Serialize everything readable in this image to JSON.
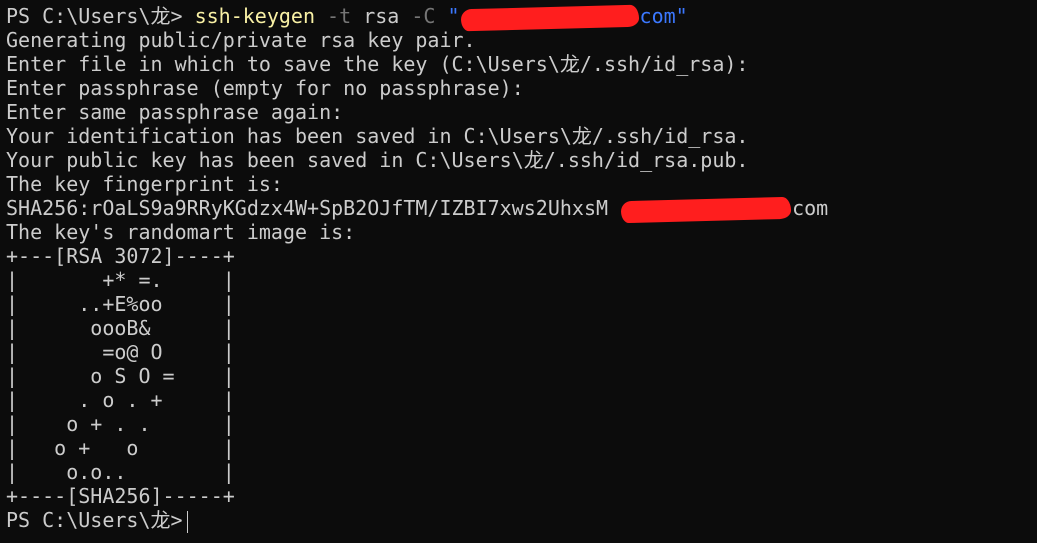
{
  "prompt": "PS C:\\Users\\龙> ",
  "command": {
    "exe": "ssh-keygen",
    "flag_t": "-t",
    "arg_t": "rsa",
    "flag_c": "-C",
    "quote_open": "\"",
    "email_tail": "com\""
  },
  "output": {
    "l1": "Generating public/private rsa key pair.",
    "l2": "Enter file in which to save the key (C:\\Users\\龙/.ssh/id_rsa):",
    "l3": "Enter passphrase (empty for no passphrase):",
    "l4": "Enter same passphrase again:",
    "l5": "Your identification has been saved in C:\\Users\\龙/.ssh/id_rsa.",
    "l6": "Your public key has been saved in C:\\Users\\龙/.ssh/id_rsa.pub.",
    "l7": "The key fingerprint is:",
    "fingerprint": "SHA256:rOaLS9a9RRyKGdzx4W+SpB2OJfTM/IZBI7xws2UhxsM ",
    "fingerprint_tail": "com",
    "l9": "The key's randomart image is:"
  },
  "randomart": [
    "+---[RSA 3072]----+",
    "|       +* =.     |",
    "|     ..+E%oo     |",
    "|      oooB&      |",
    "|       =o@ O     |",
    "|      o S O =    |",
    "|     . o . +     |",
    "|    o + . .      |",
    "|   o +   o       |",
    "|    o.o..        |",
    "+----[SHA256]-----+"
  ],
  "final_prompt": "PS C:\\Users\\龙>",
  "colors": {
    "background": "#0c0c0c",
    "text": "#cccccc",
    "command": "#f9f1a5",
    "parameter": "#767676",
    "string": "#3b78ff",
    "redaction": "#ff1e1e"
  }
}
